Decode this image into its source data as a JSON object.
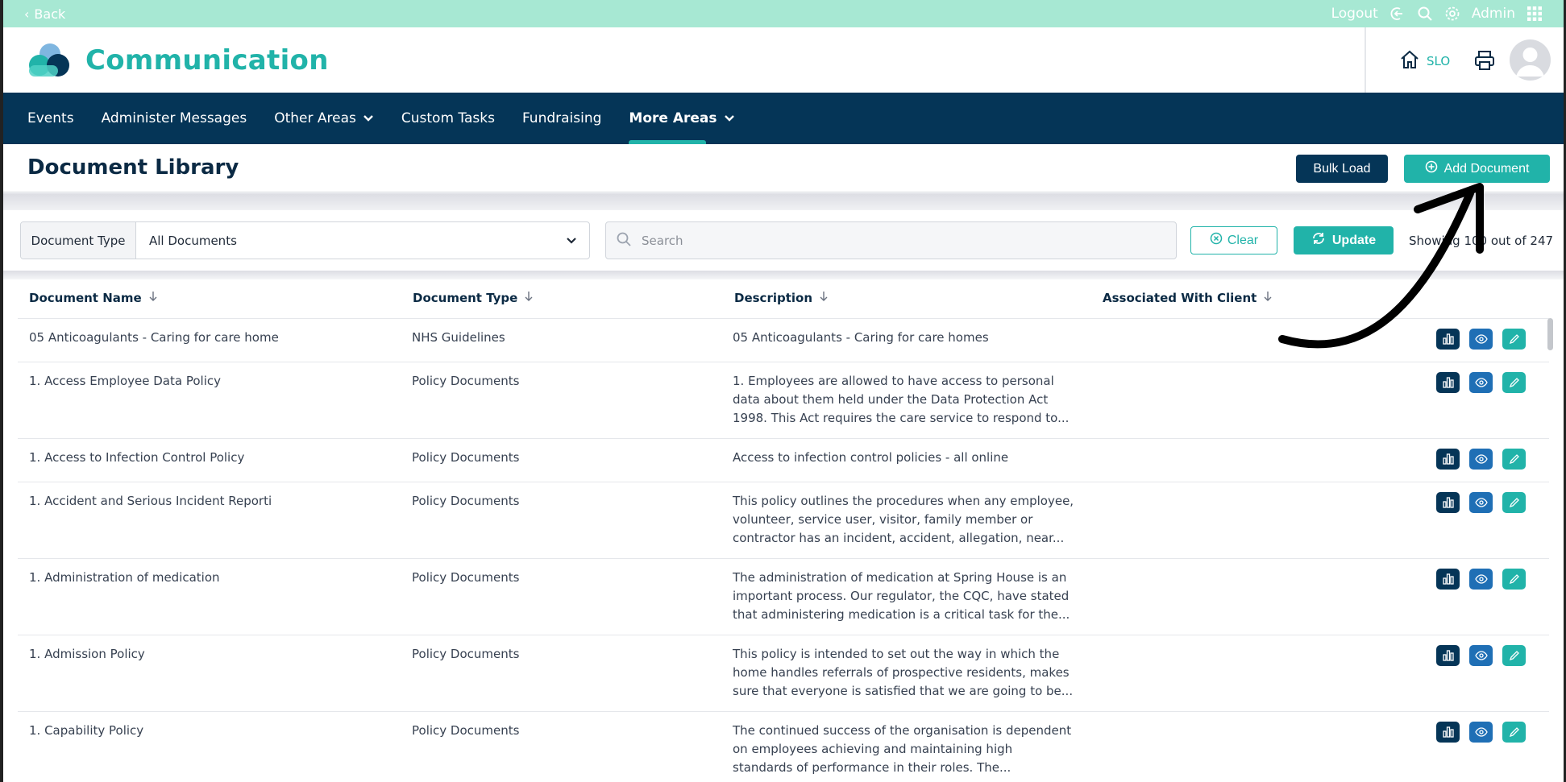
{
  "topbar": {
    "back_label": "Back",
    "logout_label": "Logout",
    "user_label": "Admin"
  },
  "header": {
    "app_title": "Communication",
    "home_label": "SLO"
  },
  "nav": {
    "items": [
      {
        "label": "Events"
      },
      {
        "label": "Administer Messages"
      },
      {
        "label": "Other Areas"
      },
      {
        "label": "Custom Tasks"
      },
      {
        "label": "Fundraising"
      },
      {
        "label": "More Areas"
      }
    ],
    "active": "More Areas"
  },
  "page": {
    "title": "Document Library",
    "bulk_load_label": "Bulk Load",
    "add_document_label": "Add Document"
  },
  "filters": {
    "doc_type_label": "Document Type",
    "doc_type_value": "All Documents",
    "search_placeholder": "Search",
    "clear_label": "Clear",
    "update_label": "Update",
    "showing_text": "Showing 100 out of 247"
  },
  "table": {
    "columns": [
      "Document Name",
      "Document Type",
      "Description",
      "Associated With Client"
    ],
    "rows": [
      {
        "name": "05 Anticoagulants - Caring for care home",
        "type": "NHS Guidelines",
        "desc": [
          "05 Anticoagulants - Caring for care homes"
        ],
        "client": ""
      },
      {
        "name": "1. Access Employee Data Policy",
        "type": "Policy Documents",
        "desc": [
          "1. Employees are allowed to have access to personal",
          "data about them held under the Data Protection Act",
          "1998. This Act requires the care service to respond to..."
        ],
        "client": ""
      },
      {
        "name": "1. Access to Infection Control Policy",
        "type": "Policy Documents",
        "desc": [
          "Access to infection control policies - all online"
        ],
        "client": ""
      },
      {
        "name": "1. Accident and Serious Incident Reporti",
        "type": "Policy Documents",
        "desc": [
          "This policy outlines the procedures when any employee,",
          "volunteer, service user, visitor, family member or",
          "contractor has an incident, accident, allegation, near..."
        ],
        "client": ""
      },
      {
        "name": "1. Administration of medication",
        "type": "Policy Documents",
        "desc": [
          "The administration of medication at Spring House is an",
          "important process. Our regulator, the CQC, have stated",
          "that administering medication is a critical task for the..."
        ],
        "client": ""
      },
      {
        "name": "1. Admission Policy",
        "type": "Policy Documents",
        "desc": [
          "This policy is intended to set out the way in which the",
          "home handles referrals of prospective residents, makes",
          "sure that everyone is satisfied that we are going to be..."
        ],
        "client": ""
      },
      {
        "name": "1. Capability Policy",
        "type": "Policy Documents",
        "desc": [
          "The continued success of the organisation is dependent",
          "on employees achieving and maintaining high",
          "standards of performance in their roles. The..."
        ],
        "client": ""
      }
    ]
  },
  "icons": {
    "row_actions": [
      "chart-icon",
      "eye-icon",
      "pencil-icon"
    ]
  },
  "colors": {
    "teal": "#21b3a9",
    "navy": "#053557",
    "topbar": "#a7e8d3",
    "view_blue": "#1f6fb5"
  }
}
